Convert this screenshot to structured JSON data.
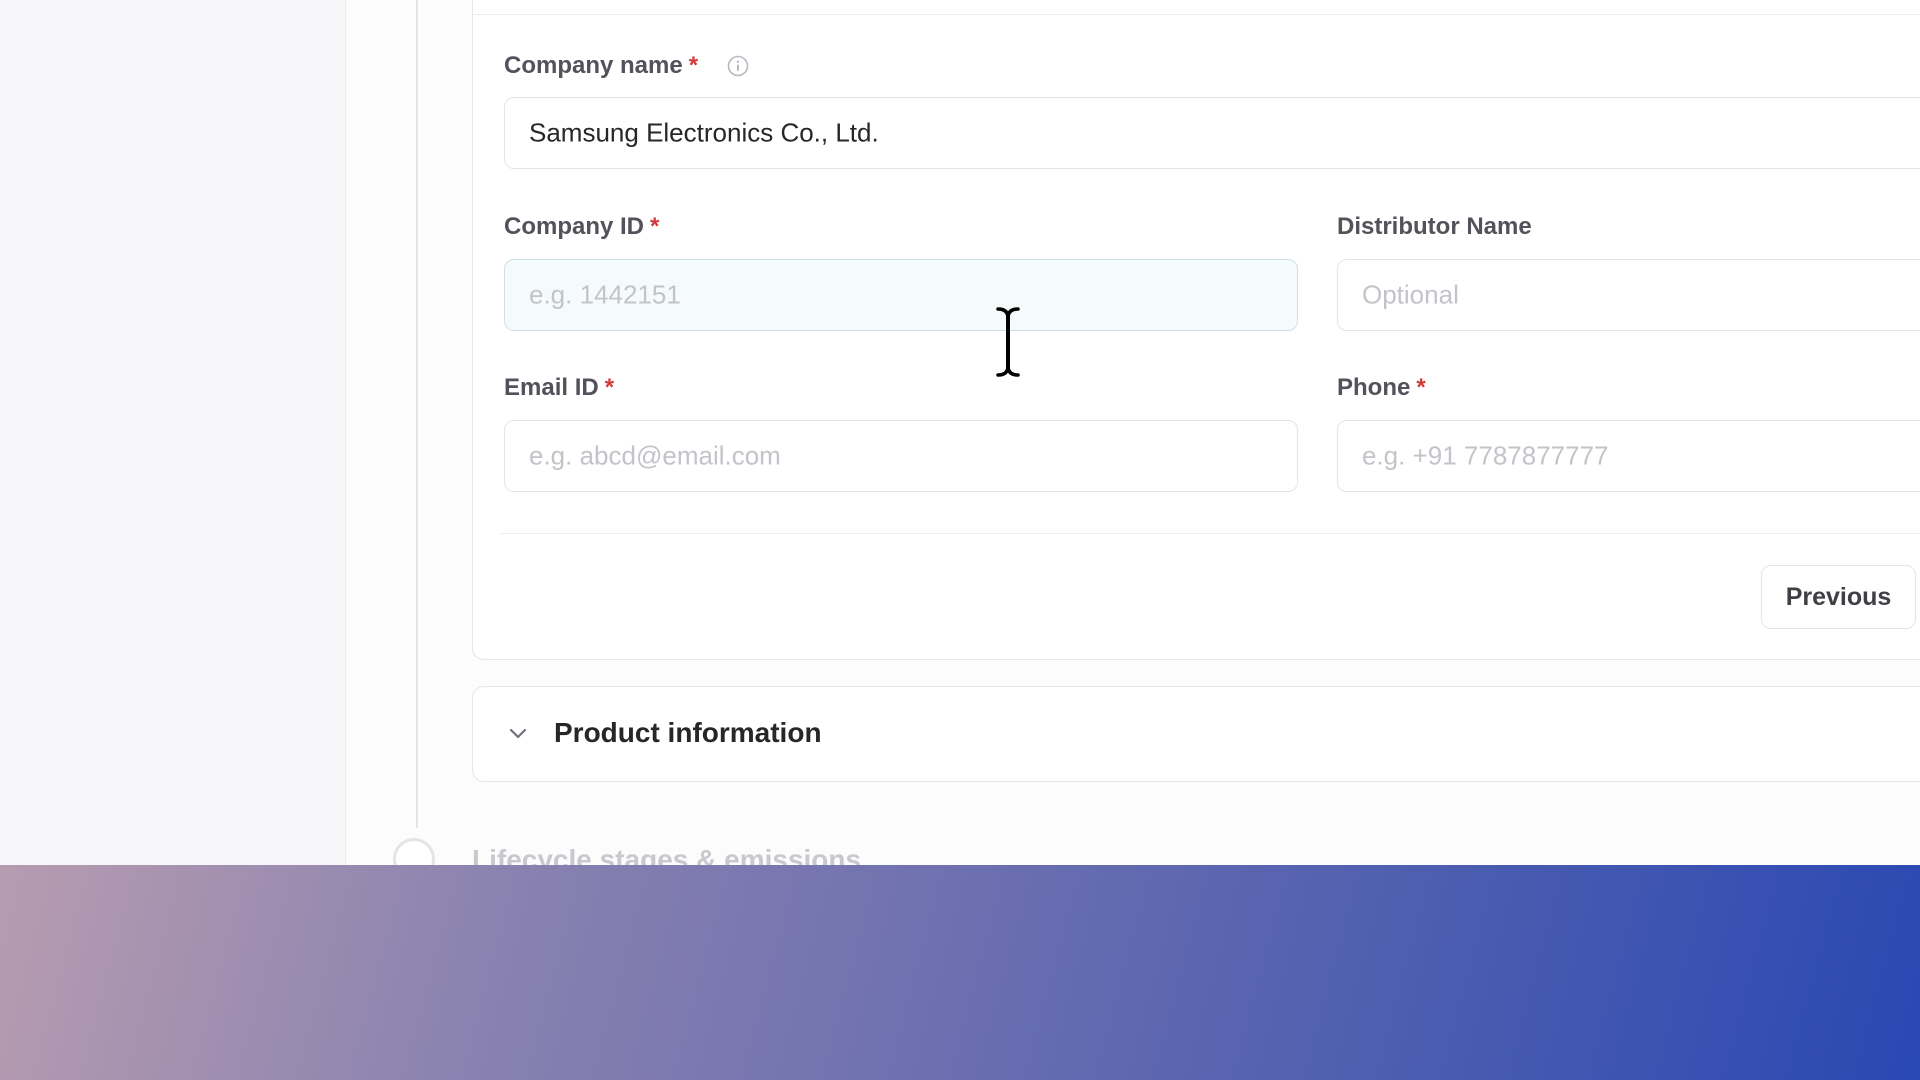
{
  "form": {
    "company_name": {
      "label": "Company name",
      "required_mark": "*",
      "value": "Samsung Electronics Co., Ltd."
    },
    "company_id": {
      "label": "Company ID",
      "required_mark": "*",
      "placeholder": "e.g. 1442151"
    },
    "distributor_name": {
      "label": "Distributor Name",
      "placeholder": "Optional"
    },
    "email_id": {
      "label": "Email ID",
      "required_mark": "*",
      "placeholder": "e.g. abcd@email.com"
    },
    "phone": {
      "label": "Phone",
      "required_mark": "*",
      "placeholder": "e.g. +91 7787877777"
    },
    "previous_label": "Previous"
  },
  "sections": {
    "product_information": "Product information",
    "lifecycle": "Lifecycle stages & emissions"
  },
  "icons": {
    "info": "info-icon",
    "chevron": "chevron-down-icon",
    "cursor": "text-cursor-icon"
  },
  "colors": {
    "required": "#d13a3a",
    "focus_border": "#cfe0e6",
    "gradient_start": "#b79cb0",
    "gradient_end": "#2a48b3"
  }
}
